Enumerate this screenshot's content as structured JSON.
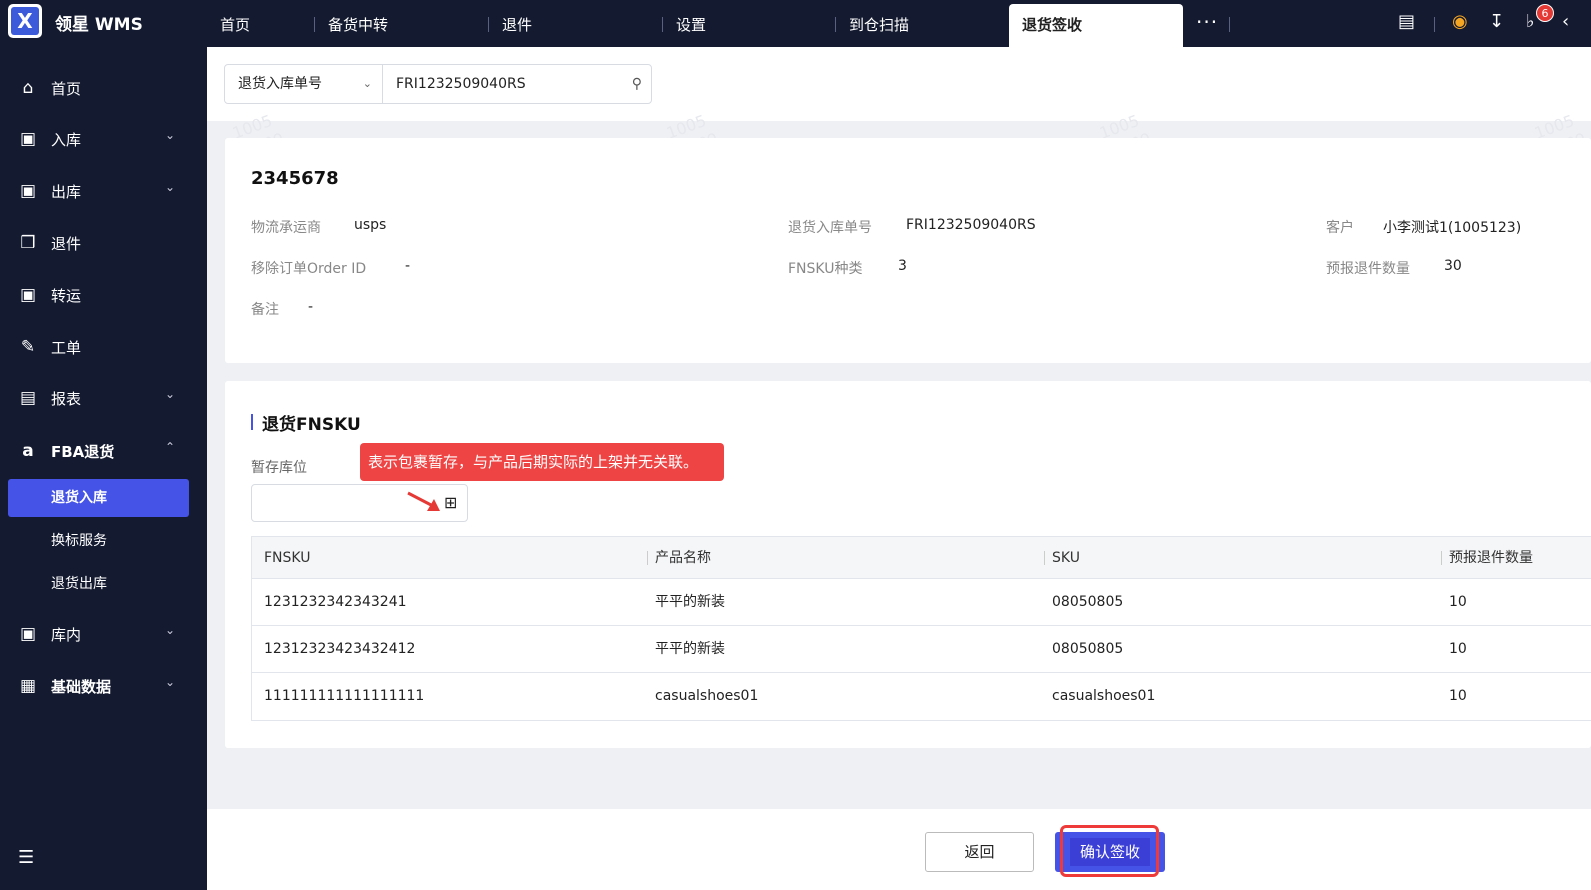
{
  "app": {
    "brand": "领星 WMS"
  },
  "topbar": {
    "tabs": [
      "首页",
      "备货中转",
      "退件",
      "设置",
      "到仓扫描"
    ],
    "active_tab": "退货签收",
    "more": "···",
    "notification_count": "6"
  },
  "sidebar": {
    "items": [
      {
        "label": "首页",
        "icon": "home-icon"
      },
      {
        "label": "入库",
        "icon": "inbound-icon"
      },
      {
        "label": "出库",
        "icon": "outbound-icon"
      },
      {
        "label": "退件",
        "icon": "return-icon"
      },
      {
        "label": "转运",
        "icon": "transfer-icon"
      },
      {
        "label": "工单",
        "icon": "work-order-icon"
      },
      {
        "label": "报表",
        "icon": "report-icon"
      },
      {
        "label": "FBA退货",
        "icon": "amazon-icon"
      },
      {
        "label": "库内",
        "icon": "warehouse-icon"
      },
      {
        "label": "基础数据",
        "icon": "grid-data-icon"
      }
    ],
    "sub_items": [
      "退货入库",
      "换标服务",
      "退货出库"
    ]
  },
  "search": {
    "select_value": "退货入库单号",
    "input_value": "FRI1232509040RS"
  },
  "detail": {
    "order_no": "2345678",
    "carrier_label": "物流承运商",
    "carrier_value": "usps",
    "return_no_label": "退货入库单号",
    "return_no_value": "FRI1232509040RS",
    "customer_label": "客户",
    "customer_value": "小李测试1(1005123)",
    "order_id_label": "移除订单Order ID",
    "order_id_value": "-",
    "fnsku_types_label": "FNSKU种类",
    "fnsku_types_value": "3",
    "forecast_qty_label": "预报退件数量",
    "forecast_qty_value": "30",
    "remark_label": "备注",
    "remark_value": "-"
  },
  "fnsku_section": {
    "title": "退货FNSKU",
    "tip": "表示包裹暂存，与产品后期实际的上架并无关联。",
    "temp_location_label": "暂存库位",
    "columns": [
      "FNSKU",
      "产品名称",
      "SKU",
      "预报退件数量"
    ],
    "rows": [
      [
        "1231232342343241",
        "平平的新装",
        "08050805",
        "10"
      ],
      [
        "12312323423432412",
        "平平的新装",
        "08050805",
        "10"
      ],
      [
        "111111111111111111",
        "casualshoes01",
        "casualshoes01",
        "10"
      ]
    ]
  },
  "footer": {
    "back_label": "返回",
    "confirm_label": "确认签收"
  },
  "watermark": {
    "line1": "1005",
    "line2": "demo"
  }
}
